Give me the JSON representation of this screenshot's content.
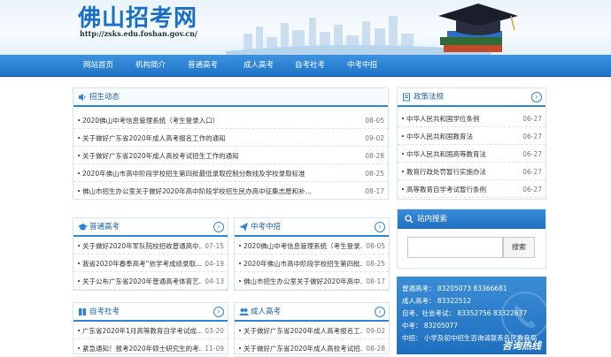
{
  "site": {
    "title": "佛山招考网",
    "url": "http://zsks.edu.foshan.gov.cn/"
  },
  "nav": [
    "网站首页",
    "机构简介",
    "普通高考",
    "成人高考",
    "自考社考",
    "中考中招"
  ],
  "news": {
    "title": "招生动态",
    "items": [
      {
        "text": "2020佛山中考信息管理系统（考生登录入口）",
        "date": "08-05"
      },
      {
        "text": "关于做好广东省2020年成人高考报名工作的通知",
        "date": "09-02"
      },
      {
        "text": "关于做好广东省2020年成人高校考试招生工作的通知",
        "date": "08-28"
      },
      {
        "text": "2020年佛山市高中阶段学校招生第四批最低录取控制分数线及学校录取标准",
        "date": "08-25"
      },
      {
        "text": "佛山市招生办公室关于做好2020年高中阶段学校招生民办高中征集志愿和补...",
        "date": "08-17"
      }
    ]
  },
  "policy": {
    "title": "政策法规",
    "items": [
      {
        "text": "中华人民共和国学位条例",
        "date": "06-27"
      },
      {
        "text": "中华人民共和国教育法",
        "date": "06-27"
      },
      {
        "text": "中华人民共和国高等教育法",
        "date": "06-27"
      },
      {
        "text": "教育行政处罚暂行实施办法",
        "date": "06-27"
      },
      {
        "text": "高等教育自学考试暂行条例",
        "date": "06-27"
      }
    ]
  },
  "gaokao": {
    "title": "普通高考",
    "items": [
      {
        "text": "关于做好2020年军队院校招收普通高中...",
        "date": "07-15"
      },
      {
        "text": "我省2020年春季高考“依学考成绩录取...",
        "date": "04-19"
      },
      {
        "text": "关于公布广东省2020年普通高考体育艺...",
        "date": "04-13"
      }
    ]
  },
  "zhongkao": {
    "title": "中考中招",
    "items": [
      {
        "text": "2020佛山中考信息管理系统（考生登录...",
        "date": "08-05"
      },
      {
        "text": "2020年佛山市高中阶段学校招生第四批...",
        "date": "08-25"
      },
      {
        "text": "佛山市招生办公室关于做好2020年高中...",
        "date": "08-17"
      }
    ]
  },
  "zikao": {
    "title": "自考社考",
    "items": [
      {
        "text": "广东省2020年1月高等教育自学考试成...",
        "date": "03-20"
      },
      {
        "text": "紧急通知！报考2020年硕士研究生的考...",
        "date": "11-09"
      }
    ]
  },
  "chengkao": {
    "title": "成人高考",
    "items": [
      {
        "text": "关于做好广东省2020年成人高考报名工...",
        "date": "09-02"
      },
      {
        "text": "关于做好广东省2020年成人高校考试招...",
        "date": "08-28"
      }
    ]
  },
  "search": {
    "title": "站内搜索",
    "button": "搜索",
    "value": ""
  },
  "contact": {
    "lines": [
      "普通高考：  83205073 83366681",
      "成人高考：  83322512",
      "自考、社会考试：  83352756 83322637",
      "中考：  83205077",
      "中招：  小学及初中招生咨询请联系各区教育局"
    ],
    "badge": "咨询热线"
  },
  "colors": {
    "accent": "#2c85d3",
    "nav": "#1f74c8"
  }
}
